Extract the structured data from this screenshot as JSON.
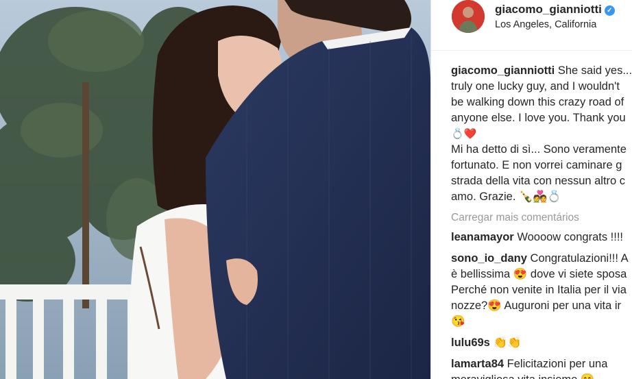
{
  "photo": {
    "alt": ""
  },
  "post": {
    "username": "giacomo_gianniotti",
    "location": "Los Angeles, California",
    "caption_lines": [
      "She said yes...",
      "truly one lucky guy, and I wouldn't",
      "be walking down this crazy road of",
      "anyone else. I love you. Thank you",
      "💍❤️",
      "Mi ha detto di sì... Sono veramente",
      "fortunato. E non vorrei caminare g",
      "strada della vita con nessun altro c",
      "amo. Grazie. 🍾💑💍"
    ],
    "load_more": "Carregar mais comentários"
  },
  "comments": [
    {
      "user": "leanamayor",
      "lines": [
        "Woooow congrats !!!!"
      ]
    },
    {
      "user": "sono_io_dany",
      "lines": [
        "Congratulazioni!!! A",
        "è bellissima 😍 dove vi siete sposa",
        "Perché non venite in Italia per il via",
        "nozze?😍 Auguroni per una vita ir",
        "😘"
      ]
    },
    {
      "user": "lulu69s",
      "lines": [
        "👏👏"
      ]
    },
    {
      "user": "lamarta84",
      "lines": [
        "Felicitazioni per una",
        "meravigliosa vita insieme 😊"
      ]
    }
  ],
  "colors": {
    "verified": "#3897f0",
    "text": "#262626",
    "muted": "#999999"
  },
  "icons": [
    "verified-badge-icon"
  ]
}
